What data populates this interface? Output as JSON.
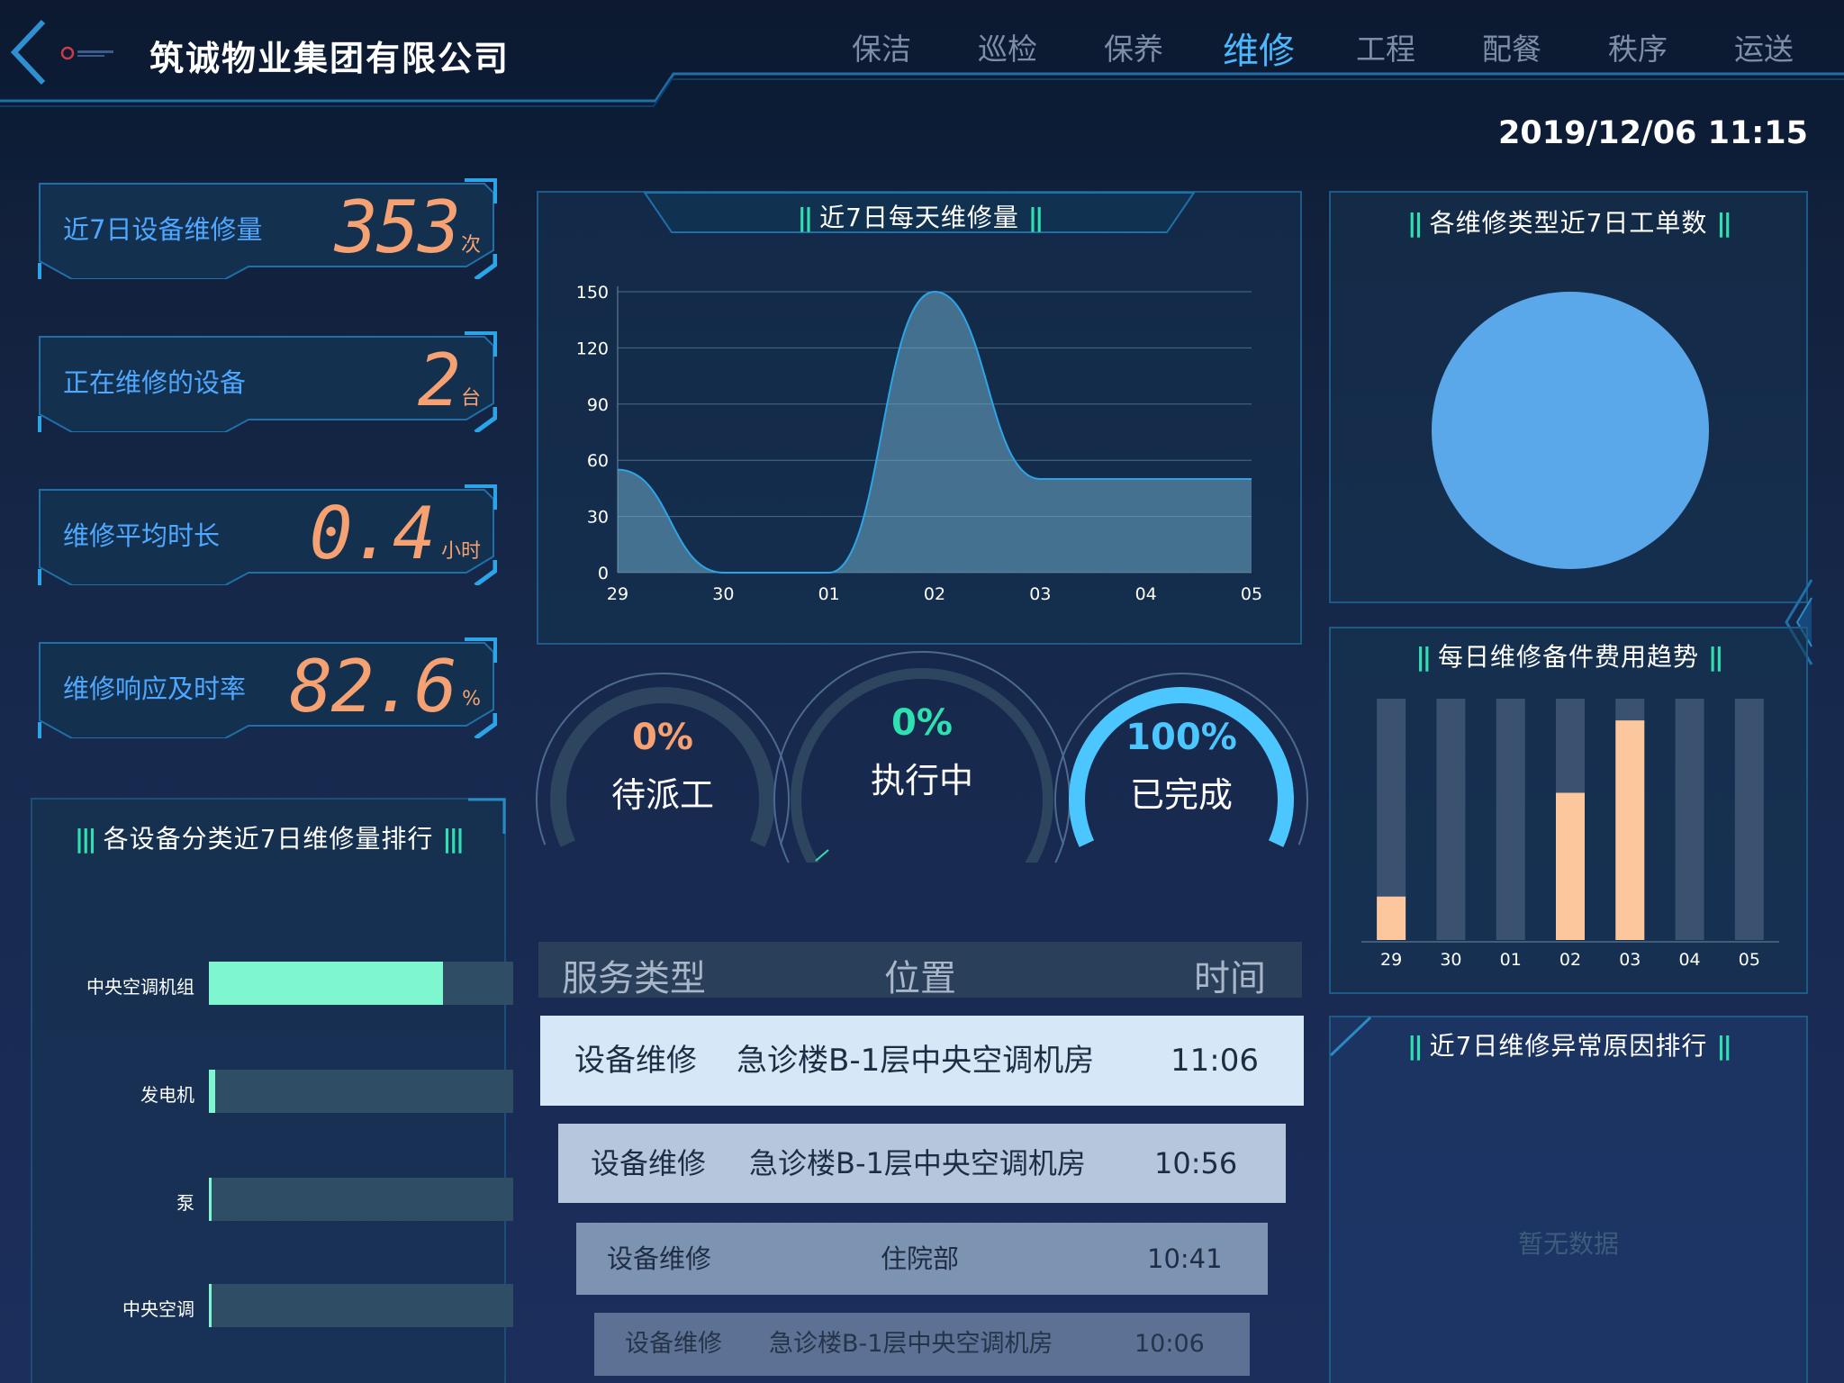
{
  "header": {
    "company": "筑诚物业集团有限公司",
    "nav": [
      {
        "label": "保洁",
        "active": false
      },
      {
        "label": "巡检",
        "active": false
      },
      {
        "label": "保养",
        "active": false
      },
      {
        "label": "维修",
        "active": true
      },
      {
        "label": "工程",
        "active": false
      },
      {
        "label": "配餐",
        "active": false
      },
      {
        "label": "秩序",
        "active": false
      },
      {
        "label": "运送",
        "active": false
      }
    ],
    "datetime": "2019/12/06 11:15"
  },
  "stats": [
    {
      "label": "近7日设备维修量",
      "value": "353",
      "unit": "次"
    },
    {
      "label": "正在维修的设备",
      "value": "2",
      "unit": "台"
    },
    {
      "label": "维修平均时长",
      "value": "0.4",
      "unit": "小时"
    },
    {
      "label": "维修响应及时率",
      "value": "82.6",
      "unit": "%"
    }
  ],
  "ranking": {
    "title": "各设备分类近7日维修量排行",
    "items": [
      {
        "name": "中央空调机组",
        "fraction": 0.77
      },
      {
        "name": "发电机",
        "fraction": 0.02
      },
      {
        "name": "泵",
        "fraction": 0.01
      },
      {
        "name": "中央空调",
        "fraction": 0.005
      }
    ]
  },
  "daily_chart": {
    "title": "近7日每天维修量",
    "chart_data": {
      "type": "area",
      "categories": [
        "29",
        "30",
        "01",
        "02",
        "03",
        "04",
        "05"
      ],
      "values": [
        55,
        0,
        0,
        150,
        50,
        50,
        50
      ],
      "yticks": [
        0,
        30,
        60,
        90,
        120,
        150
      ],
      "ylim": [
        0,
        150
      ],
      "color": "#2aa6e8"
    }
  },
  "gauges": [
    {
      "percent": "0%",
      "label": "待派工",
      "fraction": 0,
      "color": "#f6a172"
    },
    {
      "percent": "0%",
      "label": "执行中",
      "fraction": 0,
      "color": "#2fe0b0"
    },
    {
      "percent": "100%",
      "label": "已完成",
      "fraction": 1,
      "color": "#4cc6ff"
    }
  ],
  "table": {
    "headers": [
      "服务类型",
      "位置",
      "时间"
    ],
    "rows": [
      {
        "type": "设备维修",
        "location": "急诊楼B-1层中央空调机房",
        "time": "11:06"
      },
      {
        "type": "设备维修",
        "location": "急诊楼B-1层中央空调机房",
        "time": "10:56"
      },
      {
        "type": "设备维修",
        "location": "住院部",
        "time": "10:41"
      },
      {
        "type": "设备维修",
        "location": "急诊楼B-1层中央空调机房",
        "time": "10:06"
      }
    ]
  },
  "pie": {
    "title": "各维修类型近7日工单数",
    "chart_data": {
      "type": "pie",
      "slices": [
        {
          "value": 1,
          "color": "#5aa7ea"
        }
      ]
    }
  },
  "cost_chart": {
    "title": "每日维修备件费用趋势",
    "chart_data": {
      "type": "bar",
      "categories": [
        "29",
        "30",
        "01",
        "02",
        "03",
        "04",
        "05"
      ],
      "values": [
        0.18,
        0,
        0,
        0.61,
        0.91,
        0,
        0
      ],
      "ylim": [
        0,
        1
      ],
      "bar_color": "#fcc79c",
      "track_color": "#3a5170"
    }
  },
  "anomaly": {
    "title": "近7日维修异常原因排行",
    "empty_text": "暂无数据"
  }
}
